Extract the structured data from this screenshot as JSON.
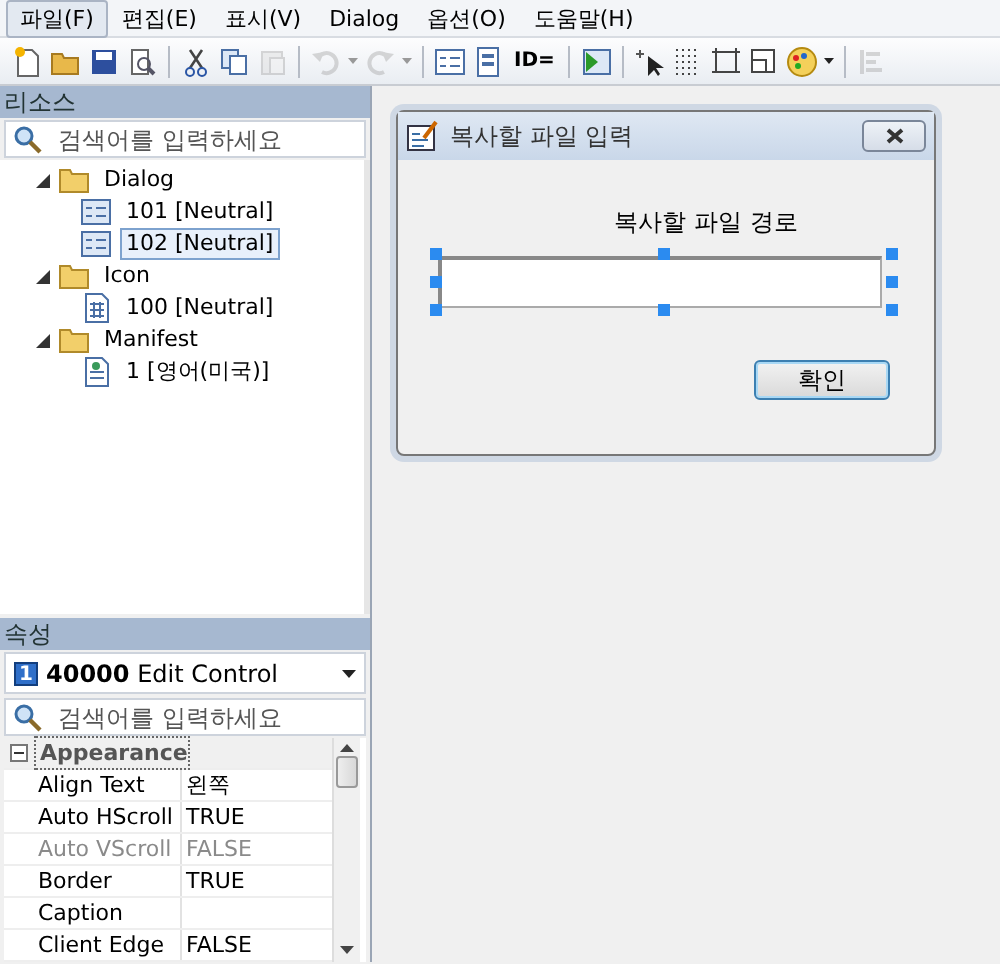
{
  "menu": [
    {
      "label": "파일(F)",
      "selected": true
    },
    {
      "label": "편집(E)",
      "selected": false
    },
    {
      "label": "표시(V)",
      "selected": false
    },
    {
      "label": "Dialog",
      "selected": false
    },
    {
      "label": "옵션(O)",
      "selected": false
    },
    {
      "label": "도움말(H)",
      "selected": false
    }
  ],
  "toolbar": [
    {
      "kind": "new",
      "disabled": false
    },
    {
      "kind": "open",
      "disabled": false
    },
    {
      "kind": "save",
      "disabled": false
    },
    {
      "kind": "preview",
      "disabled": false
    },
    {
      "kind": "separator"
    },
    {
      "kind": "cut",
      "disabled": false
    },
    {
      "kind": "copy",
      "disabled": false
    },
    {
      "kind": "paste",
      "disabled": true
    },
    {
      "kind": "separator"
    },
    {
      "kind": "undo",
      "disabled": true,
      "caret": true
    },
    {
      "kind": "redo",
      "disabled": true,
      "caret": true
    },
    {
      "kind": "separator"
    },
    {
      "kind": "form",
      "disabled": false
    },
    {
      "kind": "form2",
      "disabled": false
    },
    {
      "kind": "text",
      "label": "ID=",
      "disabled": false
    },
    {
      "kind": "separator"
    },
    {
      "kind": "run",
      "disabled": false
    },
    {
      "kind": "separator"
    },
    {
      "kind": "pointer",
      "disabled": false
    },
    {
      "kind": "grid",
      "disabled": false
    },
    {
      "kind": "frame",
      "disabled": false
    },
    {
      "kind": "form3",
      "disabled": false
    },
    {
      "kind": "palette",
      "disabled": false,
      "caret": true
    },
    {
      "kind": "separator"
    },
    {
      "kind": "align",
      "disabled": true
    }
  ],
  "resources": {
    "title": "리소스",
    "search": {
      "placeholder": "검색어를 입력하세요"
    },
    "tree": [
      {
        "label": "Dialog",
        "expanded": true,
        "children": [
          {
            "label": "101 [Neutral]",
            "kind": "dialog",
            "selected": false
          },
          {
            "label": "102 [Neutral]",
            "kind": "dialog",
            "selected": true
          }
        ]
      },
      {
        "label": "Icon",
        "expanded": true,
        "children": [
          {
            "label": "100 [Neutral]",
            "kind": "icon",
            "selected": false
          }
        ]
      },
      {
        "label": "Manifest",
        "expanded": true,
        "children": [
          {
            "label": "1 [영어(미국)]",
            "kind": "manifest",
            "selected": false
          }
        ]
      }
    ]
  },
  "properties": {
    "title": "속성",
    "object": {
      "badge": "1",
      "text": "**40000** Edit Control"
    },
    "search": {
      "placeholder": "검색어를 입력하세요"
    },
    "category": {
      "label": "Appearance",
      "expanded": true
    },
    "rows": [
      {
        "name": "Align Text",
        "value": "왼쪽",
        "disabled": false
      },
      {
        "name": "Auto HScroll",
        "value": "TRUE",
        "disabled": false
      },
      {
        "name": "Auto VScroll",
        "value": "FALSE",
        "disabled": true
      },
      {
        "name": "Border",
        "value": "TRUE",
        "disabled": false
      },
      {
        "name": "Caption",
        "value": "",
        "disabled": false
      },
      {
        "name": "Client Edge",
        "value": "FALSE",
        "disabled": false
      }
    ]
  },
  "dialog": {
    "title": "복사할 파일 입력",
    "label": "복사할 파일 경로",
    "edit_selected": true,
    "button": "확인"
  }
}
